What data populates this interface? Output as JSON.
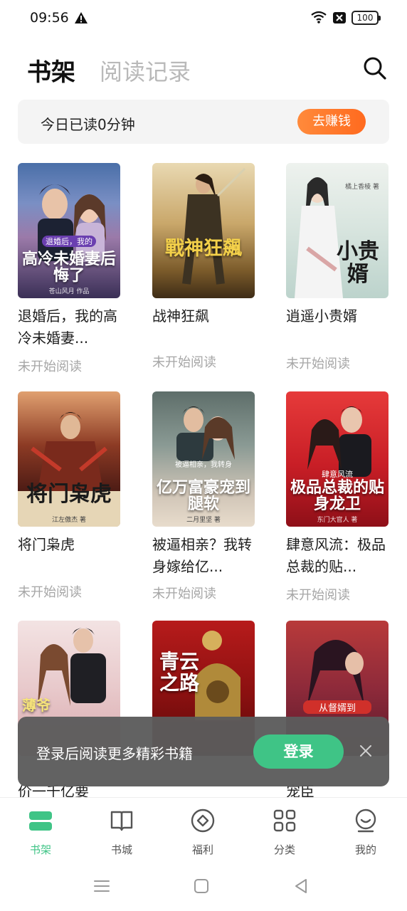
{
  "status_bar": {
    "time": "09:56",
    "battery": "100"
  },
  "header": {
    "tab_shelf": "书架",
    "tab_history": "阅读记录"
  },
  "banner": {
    "read_text": "今日已读0分钟",
    "earn_label": "去赚钱"
  },
  "books": [
    {
      "title": "退婚后，我的高冷未婚妻...",
      "status": "未开始阅读",
      "cover_sub": "退婚后，我的",
      "cover_title": "高冷未婚妻后悔了",
      "cover_author": "苍山风月 作品"
    },
    {
      "title": "战神狂飙",
      "status": "未开始阅读",
      "cover_title": "戰神狂飆",
      "cover_author": ""
    },
    {
      "title": "逍遥小贵婿",
      "status": "未开始阅读",
      "cover_title": "小贵婿",
      "cover_author": "橘上香棱 著"
    },
    {
      "title": "将门枭虎",
      "status": "未开始阅读",
      "cover_title": "将门枭虎",
      "cover_author": "江左傲杰 著"
    },
    {
      "title": "被逼相亲？我转身嫁给亿...",
      "status": "未开始阅读",
      "cover_sub": "被逼相亲，我转身",
      "cover_title": "亿万富豪宠到腿软",
      "cover_author": "二月里坚 著"
    },
    {
      "title": "肆意风流：极品总裁的贴...",
      "status": "未开始阅读",
      "cover_sub": "肆意风流",
      "cover_title": "极品总裁的贴身龙卫",
      "cover_author": "东门大官人 著"
    },
    {
      "title": "",
      "status": "",
      "cover_title": "薄爷",
      "cover_author": ""
    },
    {
      "title": "",
      "status": "",
      "cover_title": "青云之路",
      "cover_author": ""
    },
    {
      "title": "",
      "status": "",
      "cover_sub": "从督婿到",
      "cover_title": "",
      "cover_author": ""
    }
  ],
  "partial_titles": {
    "left": "价一千亿要",
    "right": "宠臣"
  },
  "login_toast": {
    "text": "登录后阅读更多精彩书籍",
    "button": "登录"
  },
  "bottom_nav": [
    {
      "label": "书架",
      "icon": "bookshelf-icon",
      "active": true
    },
    {
      "label": "书城",
      "icon": "book-open-icon",
      "active": false
    },
    {
      "label": "福利",
      "icon": "gift-circle-icon",
      "active": false
    },
    {
      "label": "分类",
      "icon": "grid-icon",
      "active": false
    },
    {
      "label": "我的",
      "icon": "profile-icon",
      "active": false
    }
  ],
  "colors": {
    "accent_green": "#3fc486",
    "accent_orange": "#ff7a2e",
    "muted_text": "#a6a6a6"
  }
}
